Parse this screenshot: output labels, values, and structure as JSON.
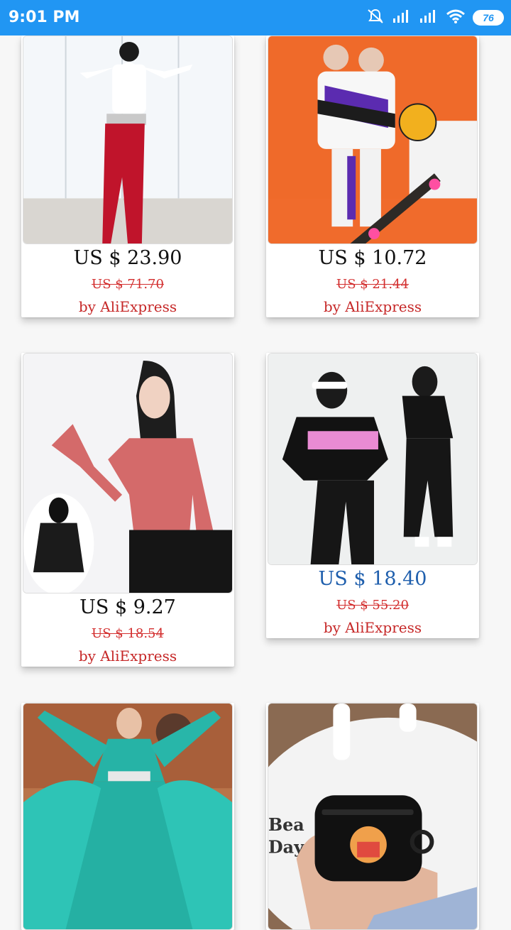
{
  "status_bar": {
    "time": "9:01 PM",
    "battery": "76",
    "icons": [
      "silent-bell-icon",
      "signal-icon",
      "signal-icon",
      "wifi-icon",
      "battery-icon"
    ]
  },
  "products": [
    {
      "price": "US $ 23.90",
      "original_price": "US $ 71.70",
      "seller": "by AliExpress",
      "image": "dancer-white-top-red-skirt"
    },
    {
      "price": "US $ 10.72",
      "original_price": "US $ 21.44",
      "seller": "by AliExpress",
      "image": "kids-hiphop-jackets"
    },
    {
      "price": "US $ 9.27",
      "original_price": "US $ 18.54",
      "seller": "by AliExpress",
      "image": "pink-mesh-top"
    },
    {
      "price": "US $ 18.40",
      "original_price": "US $ 55.20",
      "seller": "by AliExpress",
      "image": "kids-black-crop-outfit",
      "price_color": "#1f5fad"
    },
    {
      "image": "teal-flowing-dress"
    },
    {
      "image": "black-airpods-case"
    }
  ]
}
